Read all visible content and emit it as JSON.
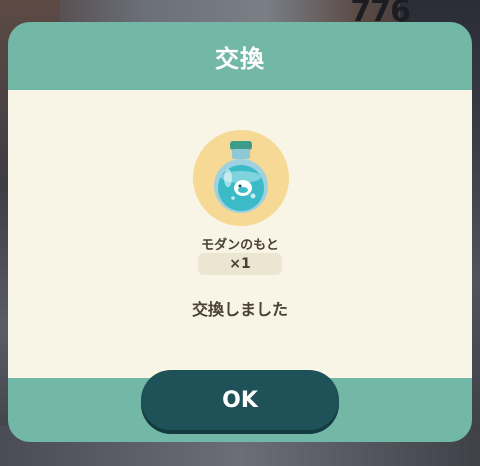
{
  "background": {
    "counter_text": "776"
  },
  "dialog": {
    "title": "交換",
    "item": {
      "name": "モダンのもと",
      "quantity": "×1",
      "icon": "potion-bottle-icon"
    },
    "message": "交換しました",
    "ok_label": "OK"
  },
  "colors": {
    "header_teal": "#73b8a6",
    "body_cream": "#f8f4e6",
    "button_dark_teal": "#1f5159",
    "item_circle": "#f5d995"
  }
}
